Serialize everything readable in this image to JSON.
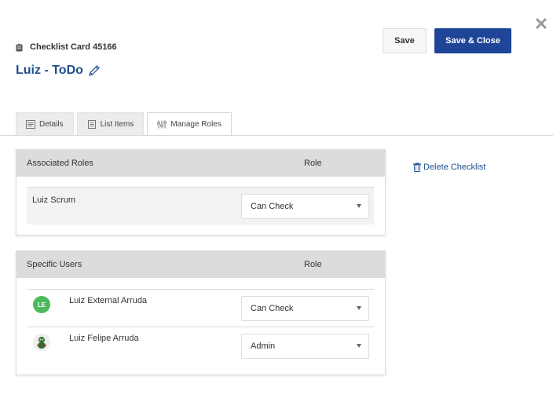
{
  "header": {
    "card_label": "Checklist Card 45166",
    "title": "Luiz - ToDo",
    "save_label": "Save",
    "save_close_label": "Save & Close",
    "close_symbol": "✕"
  },
  "tabs": [
    {
      "label": "Details",
      "icon": "details-icon",
      "active": false
    },
    {
      "label": "List Items",
      "icon": "list-items-icon",
      "active": false
    },
    {
      "label": "Manage Roles",
      "icon": "manage-roles-icon",
      "active": true
    }
  ],
  "associated_roles": {
    "header_left": "Associated Roles",
    "header_right": "Role",
    "rows": [
      {
        "name": "Luiz Scrum",
        "role": "Can Check"
      }
    ]
  },
  "specific_users": {
    "header_left": "Specific Users",
    "header_right": "Role",
    "rows": [
      {
        "name": "Luiz External Arruda",
        "initials": "LE",
        "avatar_color": "#4cba5a",
        "role": "Can Check"
      },
      {
        "name": "Luiz Felipe Arruda",
        "initials": "",
        "avatar_color": "#e8e8e8",
        "role": "Admin"
      }
    ]
  },
  "actions": {
    "delete_label": "Delete Checklist"
  },
  "colors": {
    "accent": "#1e4597",
    "title": "#1f4f8f",
    "panel_header": "#dcdcdc"
  }
}
